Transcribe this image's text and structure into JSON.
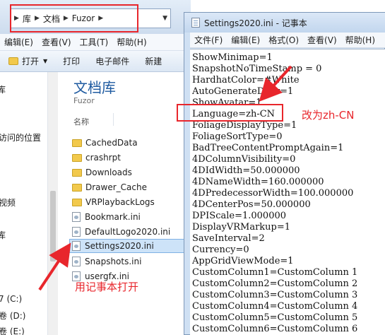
{
  "explorer": {
    "breadcrumb": [
      "库",
      "文档",
      "Fuzor"
    ],
    "menu": [
      "编辑(E)",
      "查看(V)",
      "工具(T)",
      "帮助(H)"
    ],
    "toolbar": {
      "open": "打开",
      "print": "打印",
      "email": "电子邮件",
      "new_folder": "新建"
    },
    "nav": [
      "库",
      "访问的位置",
      "视频",
      "库",
      "7 (C:)",
      "卷 (D:)",
      "卷 (E:)"
    ],
    "library_title": "文档库",
    "library_subtitle": "Fuzor",
    "column_name": "名称",
    "files": [
      {
        "name": "CachedData",
        "type": "folder"
      },
      {
        "name": "crashrpt",
        "type": "folder"
      },
      {
        "name": "Downloads",
        "type": "folder"
      },
      {
        "name": "Drawer_Cache",
        "type": "folder"
      },
      {
        "name": "VRPlaybackLogs",
        "type": "folder"
      },
      {
        "name": "Bookmark.ini",
        "type": "ini"
      },
      {
        "name": "DefaultLogo2020.ini",
        "type": "ini"
      },
      {
        "name": "Settings2020.ini",
        "type": "ini",
        "selected": true
      },
      {
        "name": "Snapshots.ini",
        "type": "ini"
      },
      {
        "name": "usergfx.ini",
        "type": "ini"
      }
    ]
  },
  "notepad": {
    "title": "Settings2020.ini - 记事本",
    "menu": [
      "文件(F)",
      "编辑(E)",
      "格式(O)",
      "查看(V)",
      "帮助(H)"
    ],
    "lines": [
      "ShowMinimap=1",
      "SnapshotNoTimeStamp = 0",
      "HardhatColor=#White",
      "AutoGenerateDoor=1",
      "ShowAvatar=1",
      "Language=zh-CN",
      "FoliageDisplayType=1",
      "FoliageSortType=0",
      "BadTreeContentPromptAgain=1",
      "4DColumnVisibility=0",
      "4DIdWidth=50.000000",
      "4DNameWidth=160.000000",
      "4DPredecessorWidth=100.000000",
      "4DCenterPos=50.000000",
      "DPIScale=1.000000",
      "DisplayVRMarkup=1",
      "SaveInterval=2",
      "Currency=0",
      "AppGridViewMode=1",
      "CustomColumn1=CustomColumn 1",
      "CustomColumn2=CustomColumn 2",
      "CustomColumn3=CustomColumn 3",
      "CustomColumn4=CustomColumn 4",
      "CustomColumn5=CustomColumn 5",
      "CustomColumn6=CustomColumn 6"
    ]
  },
  "annotations": {
    "change_to": "改为zh-CN",
    "open_with": "用记事本打开",
    "color": "#e8262c"
  }
}
